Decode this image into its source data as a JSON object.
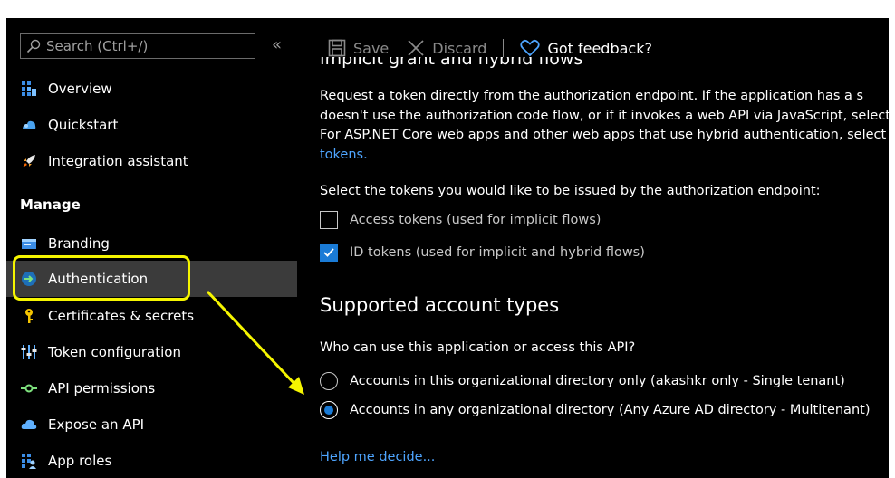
{
  "sidebar": {
    "search_placeholder": "Search (Ctrl+/)",
    "collapse_glyph": "«",
    "items_top": [
      {
        "label": "Overview",
        "icon": "overview-icon"
      },
      {
        "label": "Quickstart",
        "icon": "quickstart-icon"
      },
      {
        "label": "Integration assistant",
        "icon": "rocket-icon"
      }
    ],
    "section_title": "Manage",
    "items_manage": [
      {
        "label": "Branding",
        "icon": "branding-icon"
      },
      {
        "label": "Authentication",
        "icon": "authentication-icon",
        "selected": true
      },
      {
        "label": "Certificates & secrets",
        "icon": "key-icon"
      },
      {
        "label": "Token configuration",
        "icon": "token-config-icon"
      },
      {
        "label": "API permissions",
        "icon": "api-permissions-icon"
      },
      {
        "label": "Expose an API",
        "icon": "cloud-icon"
      },
      {
        "label": "App roles",
        "icon": "app-roles-icon"
      }
    ]
  },
  "toolbar": {
    "save_label": "Save",
    "discard_label": "Discard",
    "feedback_label": "Got feedback?"
  },
  "content": {
    "cut_heading": "Implicit grant and hybrid flows",
    "paragraph_lines": [
      "Request a token directly from the authorization endpoint. If the application has a s",
      "doesn't use the authorization code flow, or if it invokes a web API via JavaScript, select",
      "For ASP.NET Core web apps and other web apps that use hybrid authentication, select"
    ],
    "paragraph_link": "tokens.",
    "select_label": "Select the tokens you would like to be issued by the authorization endpoint:",
    "tokens": [
      {
        "label": "Access tokens (used for implicit flows)",
        "checked": false
      },
      {
        "label": "ID tokens (used for implicit and hybrid flows)",
        "checked": true
      }
    ],
    "account_heading": "Supported account types",
    "account_question": "Who can use this application or access this API?",
    "account_options": [
      {
        "label": "Accounts in this organizational directory only (akashkr only - Single tenant)",
        "selected": false
      },
      {
        "label": "Accounts in any organizational directory (Any Azure AD directory - Multitenant)",
        "selected": true
      }
    ],
    "help_link": "Help me decide..."
  },
  "colors": {
    "background": "#000000",
    "link": "#4ea5ff",
    "accent": "#1a7bd6",
    "highlight": "#f5f500",
    "selected_row": "#3b3b3b"
  }
}
